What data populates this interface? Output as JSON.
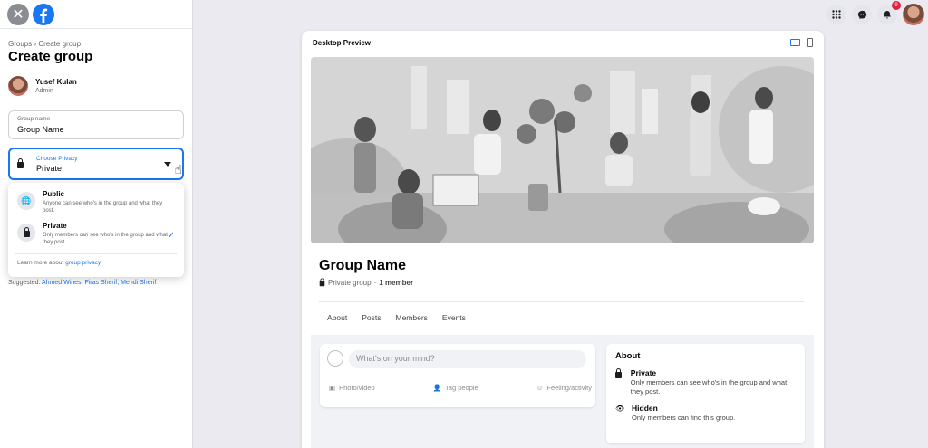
{
  "sidebar": {
    "breadcrumb": "Groups › Create group",
    "title": "Create group",
    "admin": {
      "name": "Yusef Kulan",
      "role": "Admin"
    },
    "group_name_field": {
      "label": "Group name",
      "value": "Group Name"
    },
    "privacy_field": {
      "label": "Choose Privacy",
      "value": "Private"
    },
    "privacy_options": [
      {
        "title": "Public",
        "description": "Anyone can see who's in the group and what they post.",
        "icon": "globe-icon"
      },
      {
        "title": "Private",
        "description": "Only members can see who's in the group and what they post.",
        "icon": "lock-icon",
        "selected": true
      }
    ],
    "learn_more": {
      "prefix": "Learn more about ",
      "link": "group privacy"
    },
    "suggested": {
      "label": "Suggested:",
      "names": "Ahmed Wines, Firas Sherif, Mehdi Sherif"
    }
  },
  "topnav": {
    "notification_count": "9"
  },
  "preview": {
    "title": "Desktop Preview",
    "group_name": "Group Name",
    "group_meta_privacy": "Private group",
    "group_meta_members": "1 member",
    "tabs": [
      "About",
      "Posts",
      "Members",
      "Events"
    ],
    "composer": {
      "placeholder": "What's on your mind?",
      "actions": [
        "Photo/video",
        "Tag people",
        "Feeling/activity"
      ]
    },
    "about": {
      "title": "About",
      "items": [
        {
          "title": "Private",
          "description": "Only members can see who's in the group and what they post.",
          "icon": "lock-icon"
        },
        {
          "title": "Hidden",
          "description": "Only members can find this group.",
          "icon": "eye-icon"
        }
      ]
    }
  },
  "colors": {
    "accent": "#1877f2",
    "badge": "#e41e3f"
  }
}
